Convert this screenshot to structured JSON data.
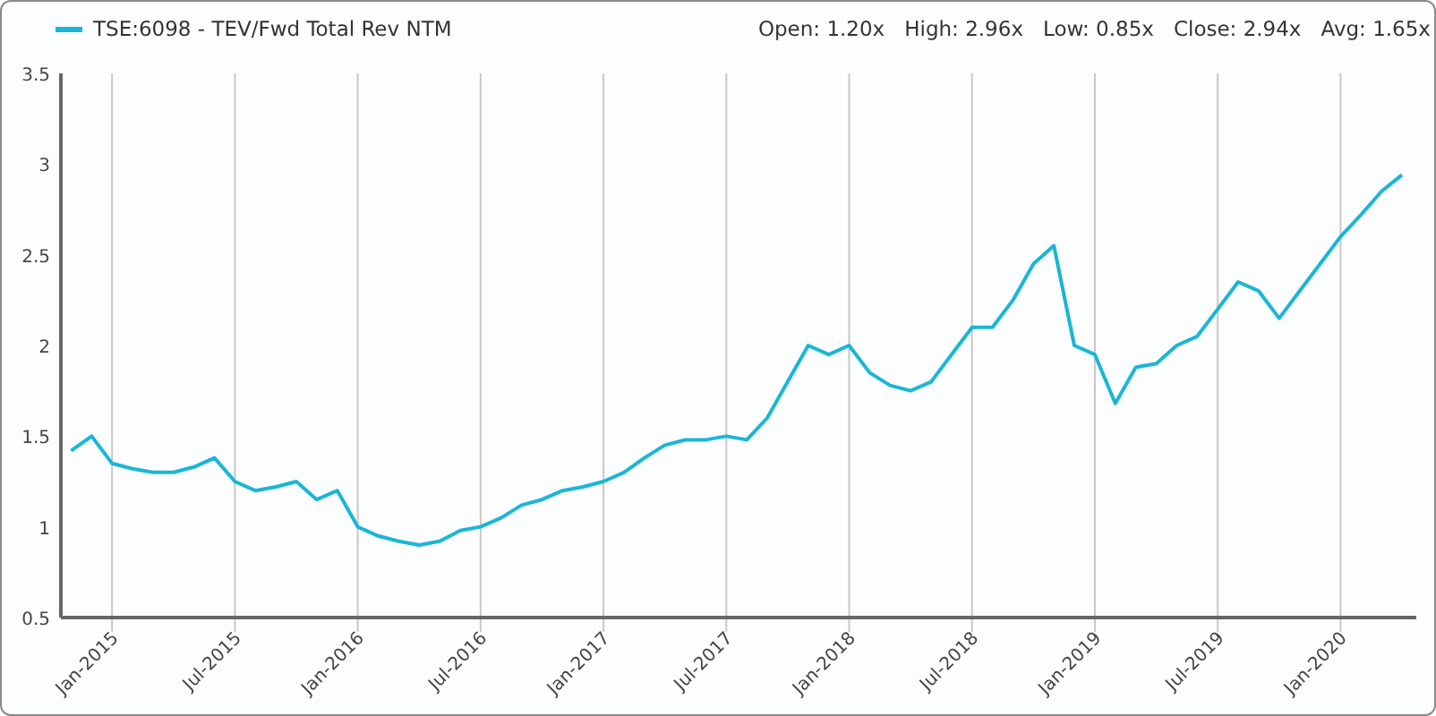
{
  "stats": [
    {
      "label": "Open:",
      "value": "1.20x"
    },
    {
      "label": "High:",
      "value": "2.96x"
    },
    {
      "label": "Low:",
      "value": "0.85x"
    },
    {
      "label": "Close:",
      "value": "2.94x"
    },
    {
      "label": "Avg:",
      "value": "1.65x"
    }
  ],
  "chart_data": {
    "type": "line",
    "categories": [
      null,
      null,
      "Jan-2015",
      null,
      null,
      null,
      null,
      null,
      "Jul-2015",
      null,
      null,
      null,
      null,
      null,
      "Jan-2016",
      null,
      null,
      null,
      null,
      null,
      "Jul-2016",
      null,
      null,
      null,
      null,
      null,
      "Jan-2017",
      null,
      null,
      null,
      null,
      null,
      "Jul-2017",
      null,
      null,
      null,
      null,
      null,
      "Jan-2018",
      null,
      null,
      null,
      null,
      null,
      "Jul-2018",
      null,
      null,
      null,
      null,
      null,
      "Jan-2019",
      null,
      null,
      null,
      null,
      null,
      "Jul-2019",
      null,
      null,
      null,
      null,
      null,
      "Jan-2020",
      null,
      null,
      null
    ],
    "series": [
      {
        "name": "TSE:6098 - TEV/Fwd Total Rev NTM",
        "color": "#1ab6d6",
        "values": [
          1.42,
          1.5,
          1.35,
          1.32,
          1.3,
          1.3,
          1.33,
          1.38,
          1.25,
          1.2,
          1.22,
          1.25,
          1.15,
          1.2,
          1.0,
          0.95,
          0.92,
          0.9,
          0.92,
          0.98,
          1.0,
          1.05,
          1.12,
          1.15,
          1.2,
          1.22,
          1.25,
          1.3,
          1.38,
          1.45,
          1.48,
          1.48,
          1.5,
          1.48,
          1.6,
          1.8,
          2.0,
          1.95,
          2.0,
          1.85,
          1.78,
          1.75,
          1.8,
          1.95,
          2.1,
          2.1,
          2.25,
          2.45,
          2.55,
          2.0,
          1.95,
          1.68,
          1.88,
          1.9,
          2.0,
          2.05,
          2.2,
          2.35,
          2.3,
          2.15,
          2.3,
          2.45,
          2.6,
          2.72,
          2.85,
          2.94
        ]
      }
    ],
    "grid": true,
    "ylim": [
      0.5,
      3.5
    ],
    "yticks": [
      {
        "value": 3.5,
        "label": "3.5"
      },
      {
        "value": 3,
        "label": "3"
      },
      {
        "value": 2.5,
        "label": "2.5"
      },
      {
        "value": 2,
        "label": "2"
      },
      {
        "value": 1.5,
        "label": "1.5"
      },
      {
        "value": 1,
        "label": "1"
      },
      {
        "value": 0.5,
        "label": "0.5"
      }
    ]
  }
}
